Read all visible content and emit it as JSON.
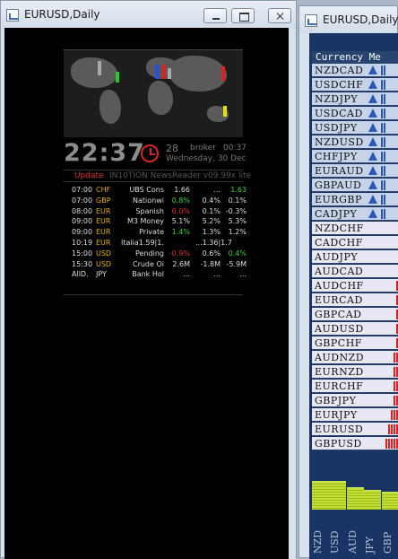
{
  "window1": {
    "title": "EURUSD,Daily"
  },
  "window2": {
    "title": "EURUSD,Daily"
  },
  "clock": {
    "time": "22:37",
    "date_num": "28",
    "broker_label": "broker",
    "broker_time": "00:37",
    "date_long": "Wednesday, 30 Dec"
  },
  "newsreader": {
    "update_label": "Update",
    "app_name": "IN10TION NewsReader v09.99x lite"
  },
  "news": [
    {
      "time": "07:00",
      "currency": "CHF",
      "event": "UBS Cons",
      "actual": "1.66",
      "forecast": "...",
      "previous": "1.63",
      "cur_color": "#e8b000",
      "act_color": "#dddddd",
      "prev_color": "#37d237"
    },
    {
      "time": "07:00",
      "currency": "GBP",
      "event": "Nationwi",
      "actual": "0.8%",
      "forecast": "0.4%",
      "previous": "0.1%",
      "cur_color": "#e8b000",
      "act_color": "#37d237",
      "prev_color": "#dddddd"
    },
    {
      "time": "08:00",
      "currency": "EUR",
      "event": "Spanish",
      "actual": "0.0%",
      "forecast": "0.1%",
      "previous": "-0.3%",
      "cur_color": "#e8b000",
      "act_color": "#e03030",
      "prev_color": "#dddddd"
    },
    {
      "time": "09:00",
      "currency": "EUR",
      "event": "M3 Money",
      "actual": "5.1%",
      "forecast": "5.2%",
      "previous": "5.3%",
      "cur_color": "#e8b000",
      "act_color": "#dddddd",
      "prev_color": "#dddddd"
    },
    {
      "time": "09:00",
      "currency": "EUR",
      "event": "Private",
      "actual": "1.4%",
      "forecast": "1.3%",
      "previous": "1.2%",
      "cur_color": "#e8b000",
      "act_color": "#37d237",
      "prev_color": "#dddddd"
    },
    {
      "time": "10:19",
      "currency": "EUR",
      "event": "Italia1.59|1.3",
      "actual": "",
      "forecast": "...1.36|1.7",
      "previous": "",
      "cur_color": "#e8b000",
      "act_color": "#dddddd",
      "prev_color": "#dddddd"
    },
    {
      "time": "15:00",
      "currency": "USD",
      "event": "Pending",
      "actual": "-0.9%",
      "forecast": "0.6%",
      "previous": "0.4%",
      "cur_color": "#e8b000",
      "act_color": "#e03030",
      "prev_color": "#37d237"
    },
    {
      "time": "15:30",
      "currency": "USD",
      "event": "Crude Oi",
      "actual": "2.6M",
      "forecast": "-1.8M",
      "previous": "-5.9M",
      "cur_color": "#e8b000",
      "act_color": "#dddddd",
      "prev_color": "#dddddd"
    },
    {
      "time": "AllD.",
      "currency": "JPY",
      "event": "Bank Hol",
      "actual": "...",
      "forecast": "...",
      "previous": "...",
      "cur_color": "#dddddd",
      "act_color": "#dddddd",
      "prev_color": "#dddddd"
    }
  ],
  "meter": {
    "header": "Currency Me",
    "rows": [
      {
        "pair": "NZDCAD",
        "bg": "#c7d3e8",
        "bars": 2,
        "color": "#2b56b5",
        "arrow": true
      },
      {
        "pair": "USDCHF",
        "bg": "#c7d3e8",
        "bars": 2,
        "color": "#2b56b5",
        "arrow": true
      },
      {
        "pair": "NZDJPY",
        "bg": "#c7d3e8",
        "bars": 2,
        "color": "#2b56b5",
        "arrow": true
      },
      {
        "pair": "USDCAD",
        "bg": "#c7d3e8",
        "bars": 2,
        "color": "#2b56b5",
        "arrow": true
      },
      {
        "pair": "USDJPY",
        "bg": "#c7d3e8",
        "bars": 2,
        "color": "#2b56b5",
        "arrow": true
      },
      {
        "pair": "NZDUSD",
        "bg": "#c7d3e8",
        "bars": 2,
        "color": "#2b56b5",
        "arrow": true
      },
      {
        "pair": "CHFJPY",
        "bg": "#c7d3e8",
        "bars": 2,
        "color": "#2b56b5",
        "arrow": true
      },
      {
        "pair": "EURAUD",
        "bg": "#c7d3e8",
        "bars": 2,
        "color": "#2b56b5",
        "arrow": true
      },
      {
        "pair": "GBPAUD",
        "bg": "#c7d3e8",
        "bars": 2,
        "color": "#2b56b5",
        "arrow": true
      },
      {
        "pair": "EURGBP",
        "bg": "#c7d3e8",
        "bars": 2,
        "color": "#2b56b5",
        "arrow": true
      },
      {
        "pair": "CADJPY",
        "bg": "#c7d3e8",
        "bars": 2,
        "color": "#2b56b5",
        "arrow": true
      },
      {
        "pair": "NZDCHF",
        "bg": "#e8e8f4",
        "bars": 2,
        "color": "#e02020",
        "arrow": false,
        "offset": 25
      },
      {
        "pair": "CADCHF",
        "bg": "#e8e8f4",
        "bars": 3,
        "color": "#e02020",
        "arrow": false,
        "offset": 22
      },
      {
        "pair": "AUDJPY",
        "bg": "#e8e8f4",
        "bars": 4,
        "color": "#e02020",
        "arrow": false,
        "offset": 19
      },
      {
        "pair": "AUDCAD",
        "bg": "#e8e8f4",
        "bars": 4,
        "color": "#e02020",
        "arrow": false,
        "offset": 19
      },
      {
        "pair": "AUDCHF",
        "bg": "#e8e8f4",
        "bars": 5,
        "color": "#e02020",
        "arrow": false,
        "offset": 16
      },
      {
        "pair": "EURCAD",
        "bg": "#e8e8f4",
        "bars": 5,
        "color": "#e02020",
        "arrow": false,
        "offset": 16
      },
      {
        "pair": "GBPCAD",
        "bg": "#e8e8f4",
        "bars": 5,
        "color": "#e02020",
        "arrow": false,
        "offset": 16
      },
      {
        "pair": "AUDUSD",
        "bg": "#e8e8f4",
        "bars": 5,
        "color": "#e02020",
        "arrow": false,
        "offset": 16
      },
      {
        "pair": "GBPCHF",
        "bg": "#e8e8f4",
        "bars": 5,
        "color": "#e02020",
        "arrow": false,
        "offset": 16
      },
      {
        "pair": "AUDNZD",
        "bg": "#e8e8f4",
        "bars": 6,
        "color": "#e02020",
        "arrow": false,
        "offset": 13
      },
      {
        "pair": "EURNZD",
        "bg": "#e8e8f4",
        "bars": 6,
        "color": "#e02020",
        "arrow": false,
        "offset": 13
      },
      {
        "pair": "EURCHF",
        "bg": "#e8e8f4",
        "bars": 6,
        "color": "#e02020",
        "arrow": false,
        "offset": 13
      },
      {
        "pair": "GBPJPY",
        "bg": "#e8e8f4",
        "bars": 6,
        "color": "#e02020",
        "arrow": false,
        "offset": 13
      },
      {
        "pair": "EURJPY",
        "bg": "#e8e8f4",
        "bars": 7,
        "color": "#e02020",
        "arrow": false,
        "offset": 10
      },
      {
        "pair": "EURUSD",
        "bg": "#e8e8f4",
        "bars": 8,
        "color": "#e02020",
        "arrow": false,
        "offset": 7
      },
      {
        "pair": "GBPUSD",
        "bg": "#e8e8f4",
        "bars": 9,
        "color": "#e02020",
        "arrow": false,
        "offset": 4
      }
    ],
    "strength": [
      {
        "label": "NZD",
        "level": 0.27
      },
      {
        "label": "USD",
        "level": 0.27
      },
      {
        "label": "AUD",
        "level": 0.21
      },
      {
        "label": "JPY",
        "level": 0.19
      },
      {
        "label": "GBP",
        "level": 0.17
      }
    ]
  }
}
